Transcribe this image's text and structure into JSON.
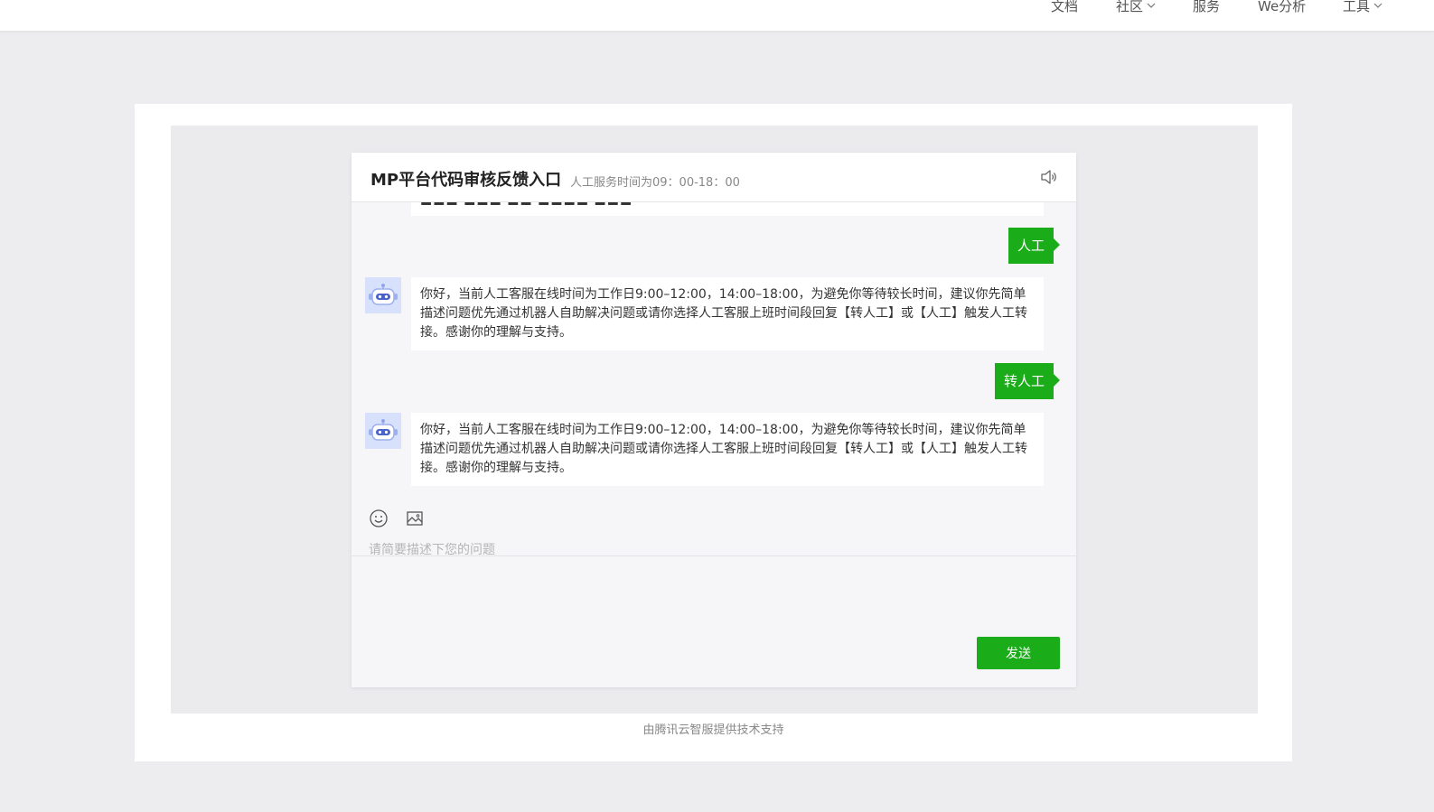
{
  "nav": {
    "items": [
      {
        "label": "文档",
        "has_dropdown": false
      },
      {
        "label": "社区",
        "has_dropdown": true
      },
      {
        "label": "服务",
        "has_dropdown": false
      },
      {
        "label": "We分析",
        "has_dropdown": false
      },
      {
        "label": "工具",
        "has_dropdown": true
      }
    ]
  },
  "chat": {
    "title": "MP平台代码审核反馈入口",
    "service_hours": "人工服务时间为09：00-18：00",
    "speaker_icon": "speaker-icon",
    "messages": [
      {
        "role": "user",
        "text": "人工"
      },
      {
        "role": "bot",
        "text": "你好，当前人工客服在线时间为工作日9:00–12:00，14:00–18:00，为避免你等待较长时间，建议你先简单描述问题优先通过机器人自助解决问题或请你选择人工客服上班时间段回复【转人工】或【人工】触发人工转接。感谢你的理解与支持。"
      },
      {
        "role": "user",
        "text": "转人工"
      },
      {
        "role": "bot",
        "text": "你好，当前人工客服在线时间为工作日9:00–12:00，14:00–18:00，为避免你等待较长时间，建议你先简单描述问题优先通过机器人自助解决问题或请你选择人工客服上班时间段回复【转人工】或【人工】触发人工转接。感谢你的理解与支持。"
      }
    ],
    "input_placeholder": "请简要描述下您的问题",
    "send_label": "发送"
  },
  "footer": {
    "powered_by": "由腾讯云智服提供技术支持"
  },
  "colors": {
    "accent_green": "#1aad19",
    "page_bg": "#ededf0",
    "chat_bg": "#f6f6f9",
    "avatar_bg": "#d7e1fb"
  }
}
